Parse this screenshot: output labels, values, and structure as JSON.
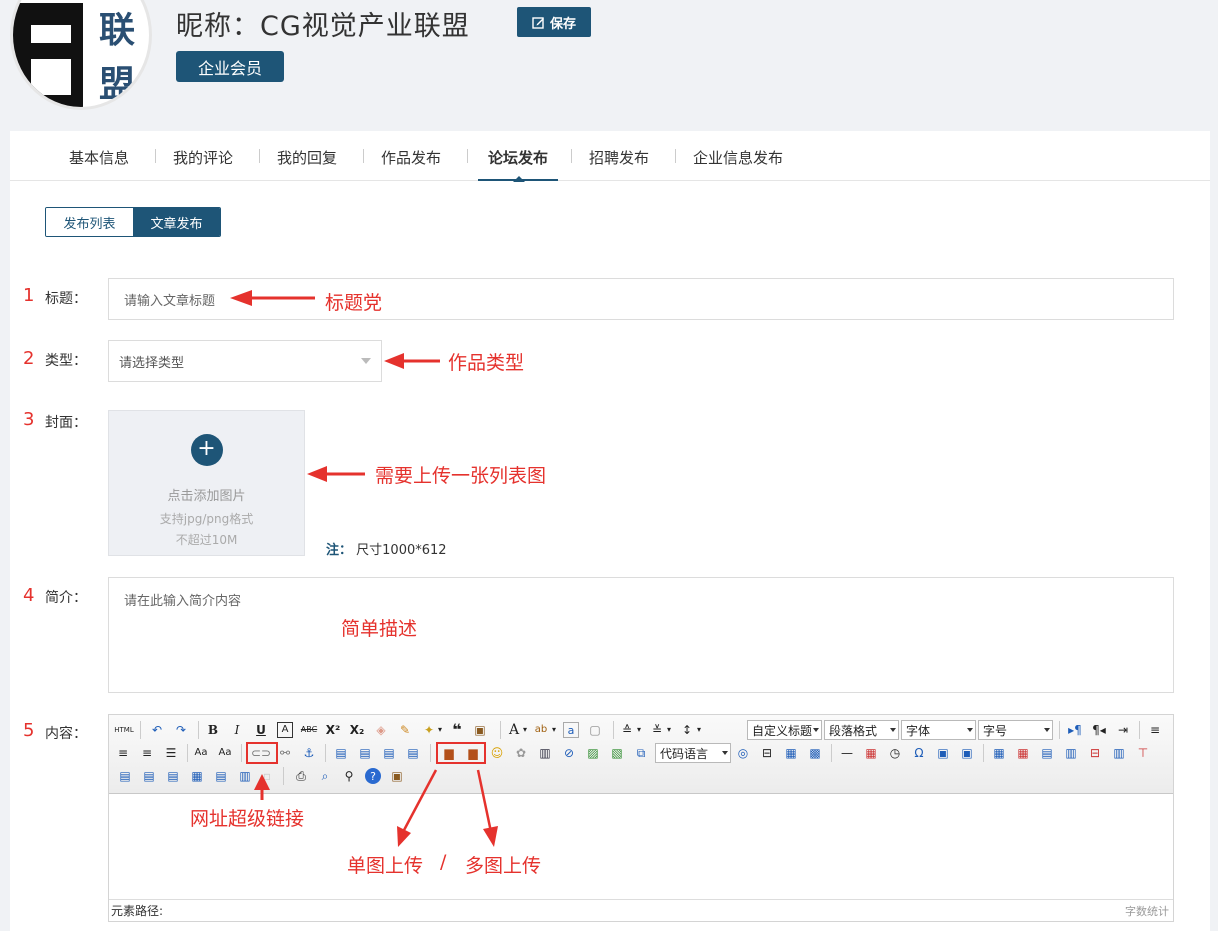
{
  "header": {
    "avatar_text": [
      "联",
      "盟"
    ],
    "nickname": "昵称：CG视觉产业联盟",
    "save_label": "保存",
    "badge": "企业会员"
  },
  "tabs": [
    "基本信息",
    "我的评论",
    "我的回复",
    "作品发布",
    "论坛发布",
    "招聘发布",
    "企业信息发布"
  ],
  "active_tab": "论坛发布",
  "segment": [
    "发布列表",
    "文章发布"
  ],
  "form": {
    "title": {
      "num": "1",
      "label": "标题：",
      "placeholder": "请输入文章标题"
    },
    "type": {
      "num": "2",
      "label": "类型：",
      "value": "请选择类型"
    },
    "cover": {
      "num": "3",
      "label": "封面：",
      "plus": "+",
      "add_text": "点击添加图片",
      "format": "支持jpg/png格式",
      "limit": "不超过10M",
      "note_label": "注：",
      "note": "尺寸1000*612"
    },
    "summary": {
      "num": "4",
      "label": "简介：",
      "placeholder": "请在此输入简介内容"
    },
    "content": {
      "num": "5",
      "label": "内容："
    }
  },
  "editor": {
    "selects": [
      "自定义标题",
      "段落格式",
      "字体",
      "字号",
      "代码语言"
    ],
    "path_label": "元素路径:",
    "word_count": "字数统计"
  },
  "annotations": {
    "title": "标题党",
    "type": "作品类型",
    "cover": "需要上传一张列表图",
    "summary": "简单描述",
    "link": "网址超级链接",
    "single_image": "单图上传",
    "slash": "/",
    "multi_image": "多图上传",
    "color": "#e5322d"
  }
}
